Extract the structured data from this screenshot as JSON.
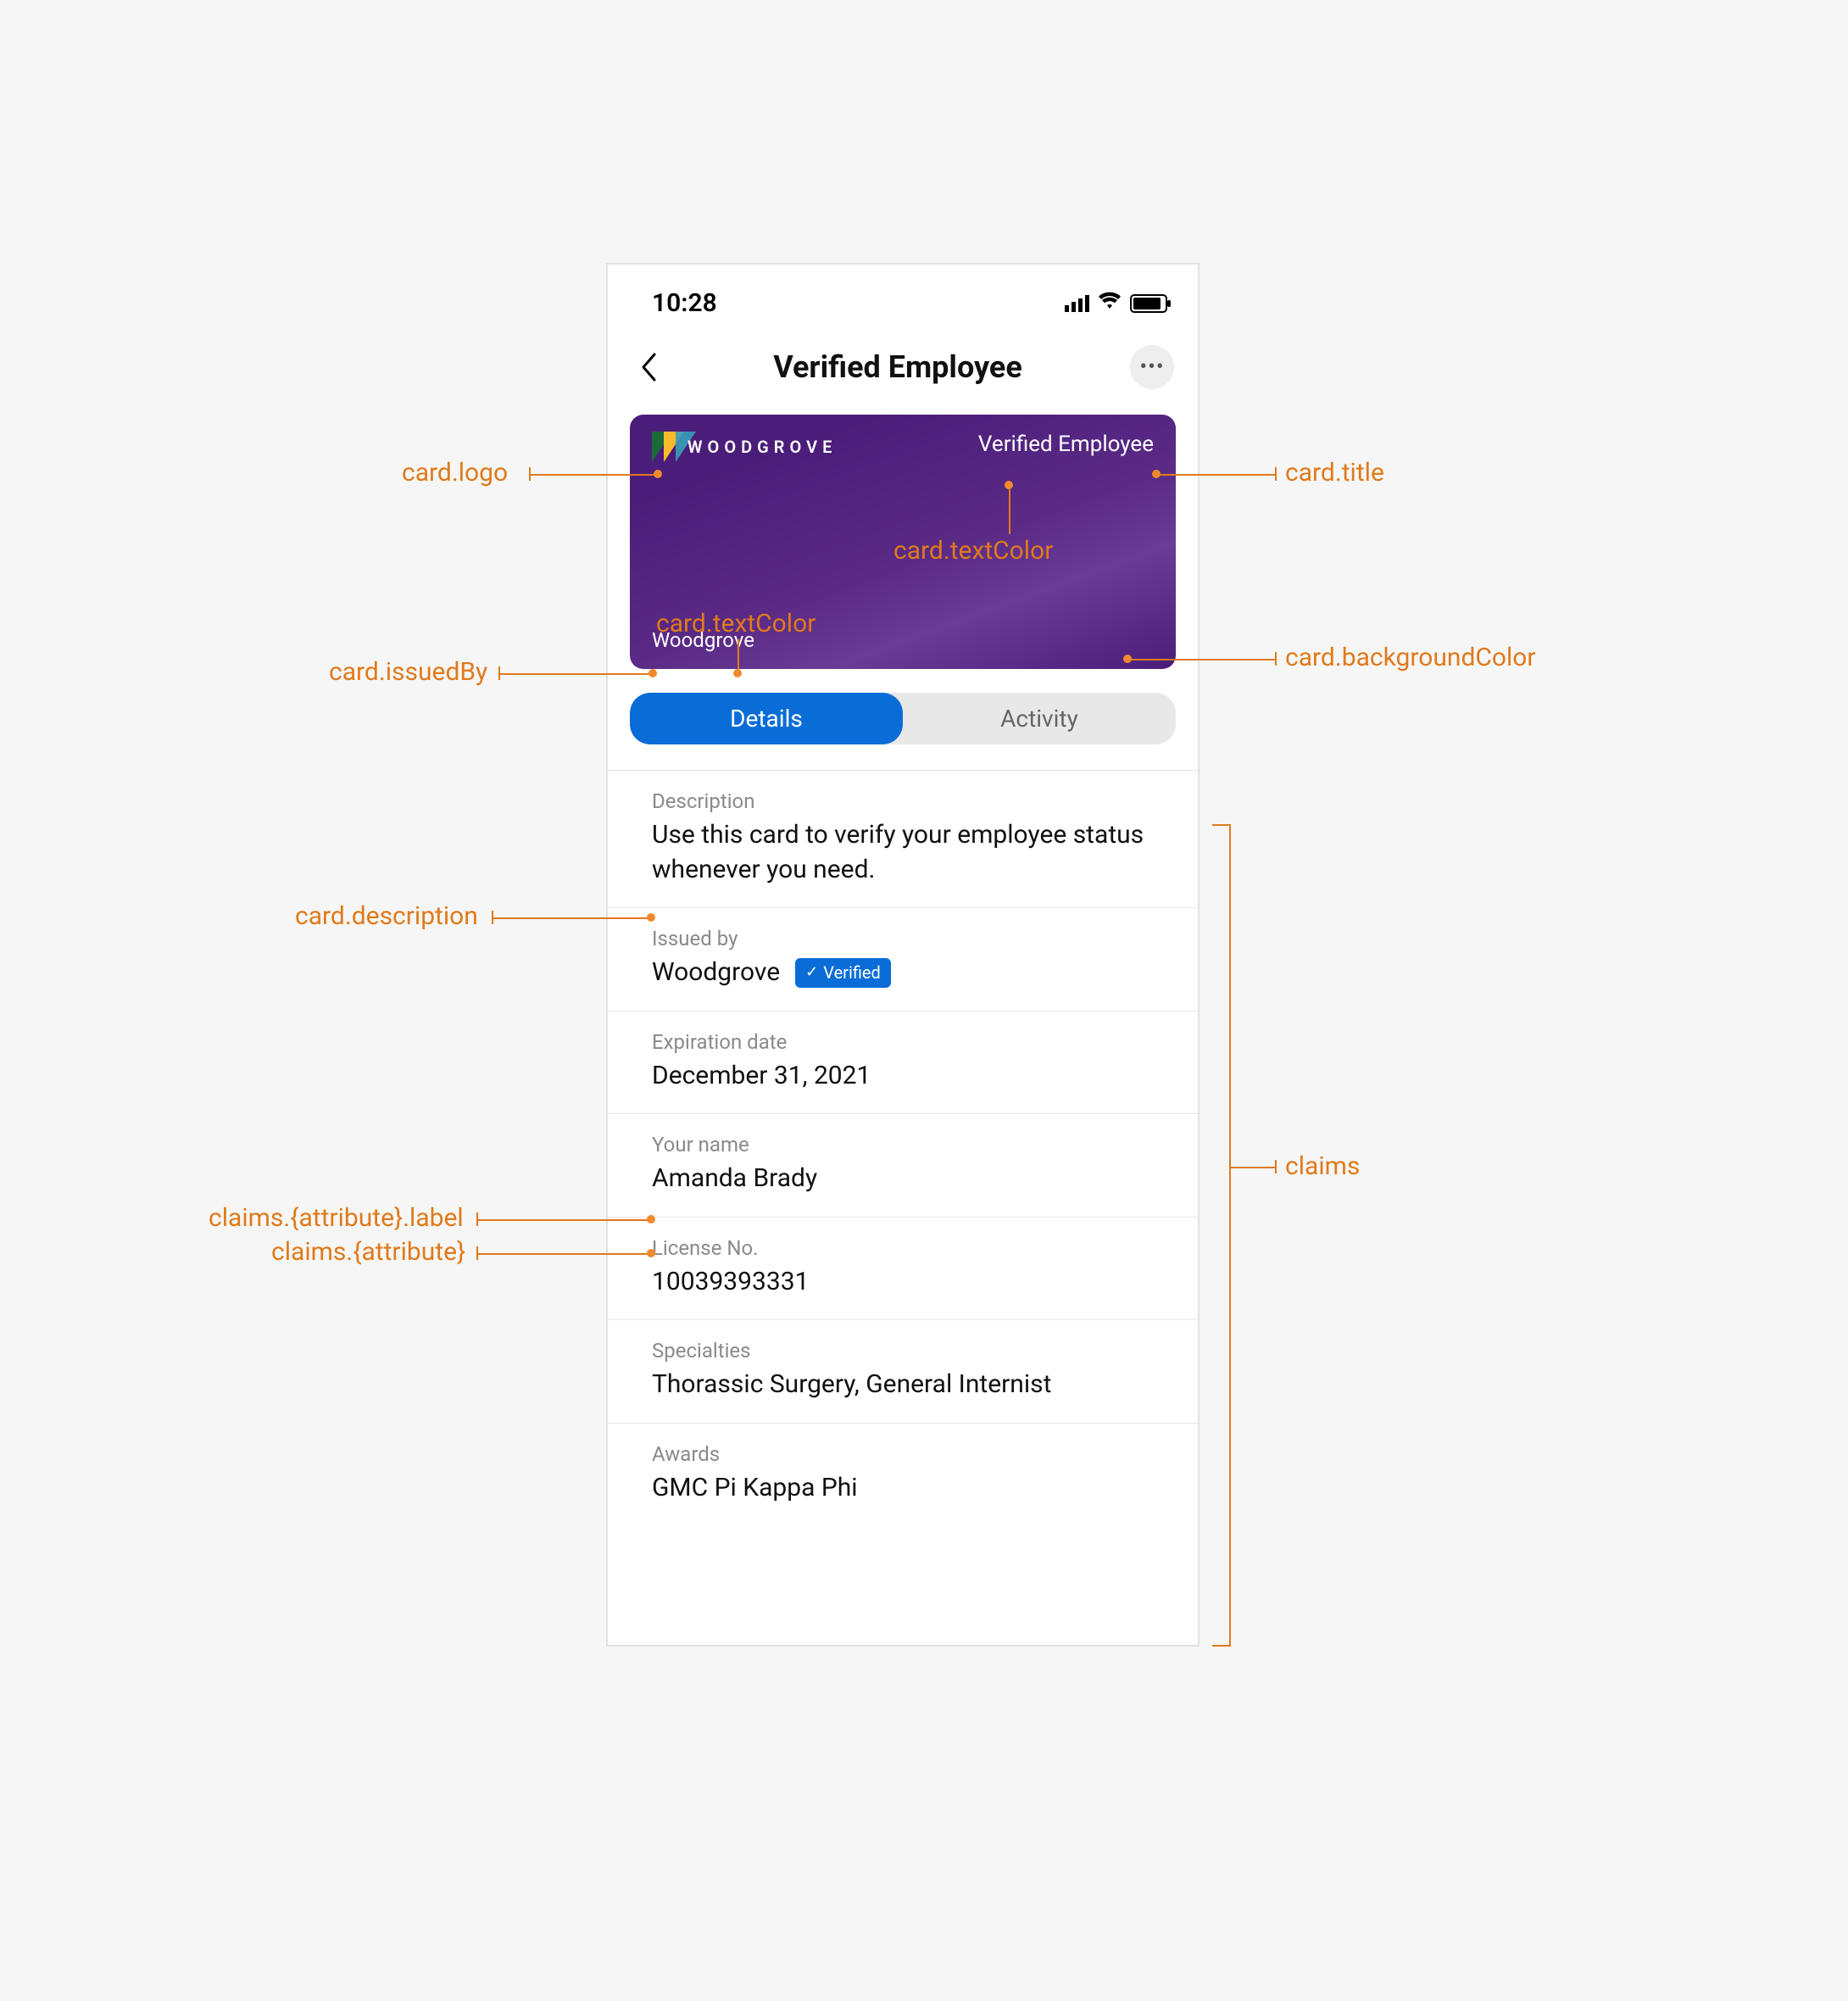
{
  "statusbar": {
    "time": "10:28"
  },
  "header": {
    "title": "Verified Employee"
  },
  "card": {
    "logo_text": "WOODGROVE",
    "title": "Verified Employee",
    "issuer": "Woodgrove"
  },
  "tabs": {
    "details": "Details",
    "activity": "Activity"
  },
  "details": {
    "description_label": "Description",
    "description_value": "Use this card to verify your employee status whenever you need.",
    "issued_by_label": "Issued by",
    "issued_by_value": "Woodgrove",
    "verified_badge": "Verified",
    "expiration_label": "Expiration date",
    "expiration_value": "December 31, 2021",
    "name_label": "Your name",
    "name_value": "Amanda Brady",
    "license_label": "License No.",
    "license_value": "10039393331",
    "specialties_label": "Specialties",
    "specialties_value": "Thorassic Surgery, General Internist",
    "awards_label": "Awards",
    "awards_value": "GMC Pi Kappa Phi"
  },
  "annotations": {
    "card_logo": "card.logo",
    "card_title": "card.title",
    "card_textColor1": "card.textColor",
    "card_textColor2": "card.textColor",
    "card_backgroundColor": "card.backgroundColor",
    "card_issuedBy": "card.issuedBy",
    "card_description": "card.description",
    "claims_label": "claims.{attribute}.label",
    "claims_attr": "claims.{attribute}",
    "claims": "claims"
  }
}
